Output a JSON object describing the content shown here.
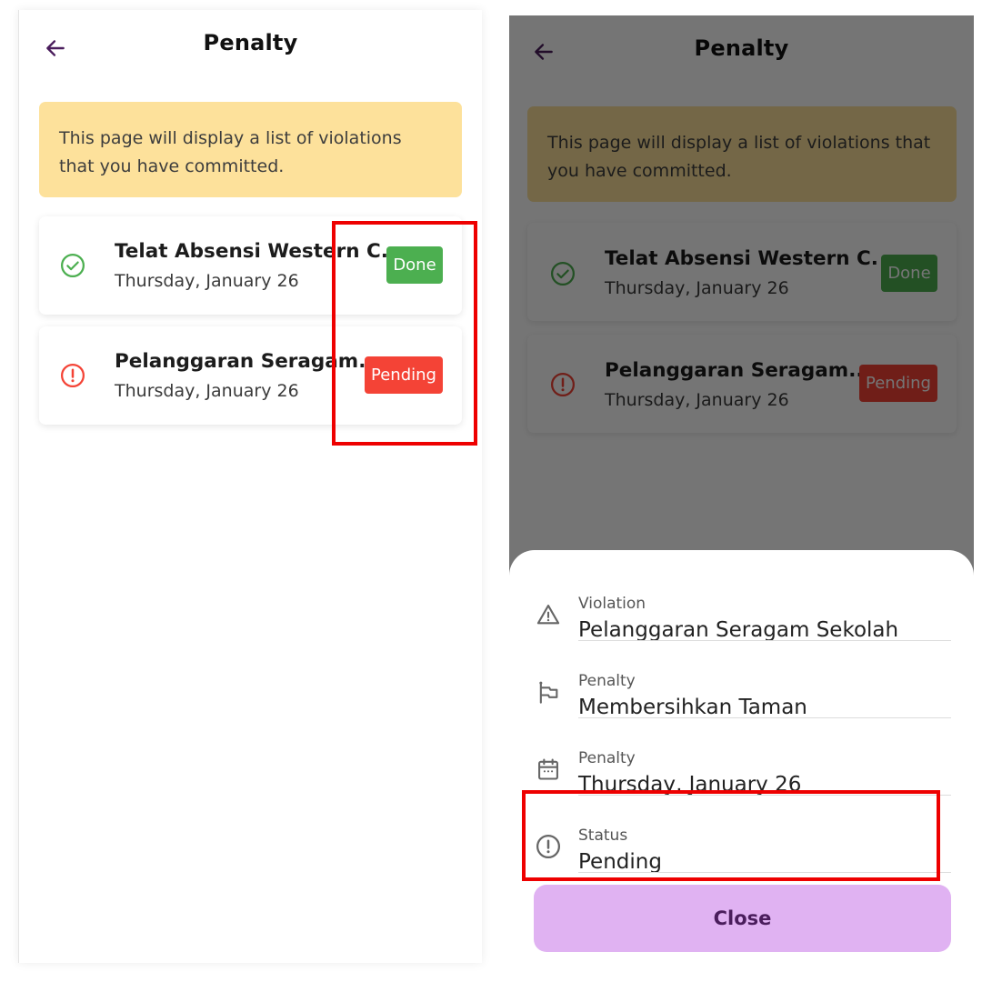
{
  "screens": {
    "list": {
      "title": "Penalty",
      "banner_text": "This page will display a list of violations that you have committed.",
      "items": [
        {
          "title": "Telat Absensi Western C...",
          "date": "Thursday, January 26",
          "status": "Done",
          "status_icon": "check-circle-icon",
          "status_color": "#4caf50"
        },
        {
          "title": "Pelanggaran Seragam...",
          "date": "Thursday, January 26",
          "status": "Pending",
          "status_icon": "alert-circle-icon",
          "status_color": "#f44336"
        }
      ]
    },
    "detail": {
      "title": "Penalty",
      "banner_text": "This page will display a list of violations that you have committed.",
      "items": [
        {
          "title": "Telat Absensi Western C...",
          "date": "Thursday, January 26",
          "status": "Done"
        },
        {
          "title": "Pelanggaran Seragam...",
          "date": "Thursday, January 26",
          "status": "Pending"
        }
      ],
      "sheet": {
        "rows": [
          {
            "label": "Violation",
            "value": "Pelanggaran Seragam Sekolah",
            "icon": "warning-triangle-icon"
          },
          {
            "label": "Penalty",
            "value": "Membersihkan Taman",
            "icon": "flag-icon"
          },
          {
            "label": "Penalty",
            "value": "Thursday, January 26",
            "icon": "calendar-icon"
          },
          {
            "label": "Status",
            "value": "Pending",
            "icon": "alert-circle-icon"
          }
        ],
        "close_label": "Close"
      }
    }
  },
  "colors": {
    "accent": "#4a1d5c",
    "banner": "#fde19b",
    "done": "#4caf50",
    "pending": "#f44336",
    "close_button": "#e0b2f2",
    "highlight": "#ee0000"
  }
}
